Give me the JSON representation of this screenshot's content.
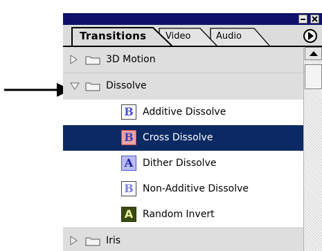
{
  "tabs": [
    {
      "label": "Transitions",
      "active": true
    },
    {
      "label": "Video",
      "active": false
    },
    {
      "label": "Audio",
      "active": false
    }
  ],
  "rows": [
    {
      "type": "folder",
      "label": "3D Motion",
      "expanded": false,
      "icon": "folder-icon"
    },
    {
      "type": "folder",
      "label": "Dissolve",
      "expanded": true,
      "icon": "folder-icon"
    },
    {
      "type": "item",
      "label": "Additive Dissolve",
      "selected": false,
      "icon": "additive-dissolve-icon",
      "glyph": "B"
    },
    {
      "type": "item",
      "label": "Cross Dissolve",
      "selected": true,
      "icon": "cross-dissolve-icon",
      "glyph": "B"
    },
    {
      "type": "item",
      "label": "Dither Dissolve",
      "selected": false,
      "icon": "dither-dissolve-icon",
      "glyph": "A"
    },
    {
      "type": "item",
      "label": "Non-Additive Dissolve",
      "selected": false,
      "icon": "non-additive-dissolve-icon",
      "glyph": "B"
    },
    {
      "type": "item",
      "label": "Random Invert",
      "selected": false,
      "icon": "random-invert-icon",
      "glyph": "A"
    },
    {
      "type": "folder",
      "label": "Iris",
      "expanded": false,
      "icon": "folder-icon"
    }
  ],
  "colors": {
    "titlebar": "#10106b",
    "selection": "#0b2a63",
    "panel": "#dedede"
  }
}
